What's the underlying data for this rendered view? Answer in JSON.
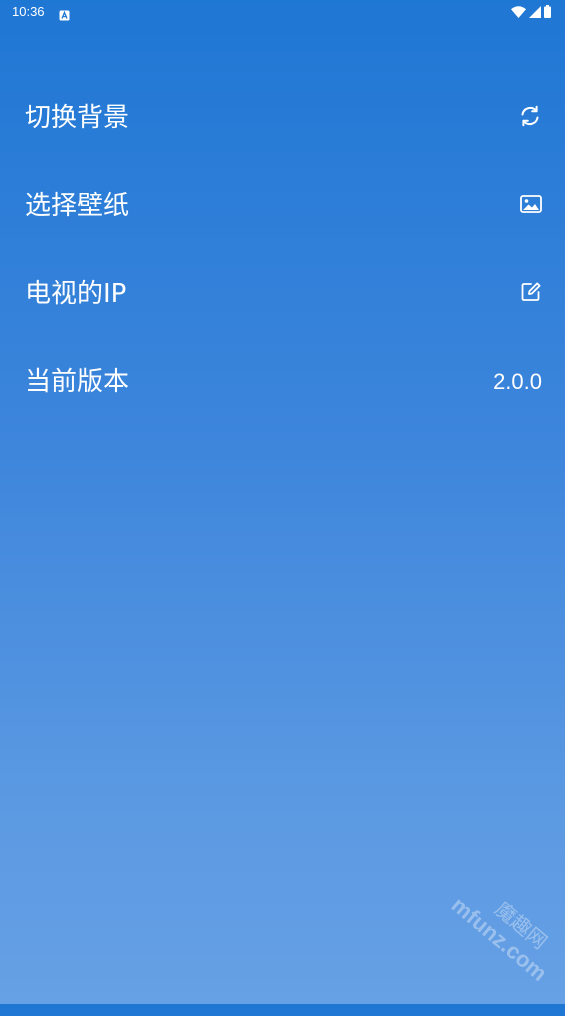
{
  "status_bar": {
    "time": "10:36",
    "notification_icon": "app-notification-icon",
    "right_icons": [
      "wifi-icon",
      "cellular-signal-icon",
      "battery-icon"
    ]
  },
  "settings": {
    "items": [
      {
        "label": "切换背景",
        "icon": "refresh-icon"
      },
      {
        "label": "选择壁纸",
        "icon": "image-icon"
      },
      {
        "label": "电视的IP",
        "icon": "edit-icon"
      },
      {
        "label": "当前版本",
        "value": "2.0.0"
      }
    ]
  },
  "watermark": {
    "text_cn": "魔趣网",
    "text_en": "mfunz.com"
  },
  "colors": {
    "background_top": "#1f77d4",
    "background_bottom": "#66a0e5",
    "text": "#ffffff"
  }
}
